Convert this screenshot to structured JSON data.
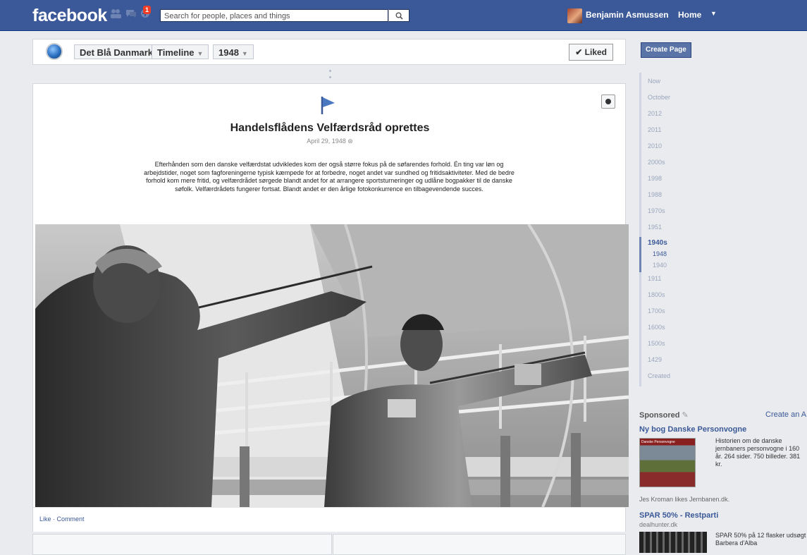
{
  "topbar": {
    "logo": "facebook",
    "notification_count": "1",
    "search_placeholder": "Search for people, places and things",
    "user_name": "Benjamin Asmussen",
    "home_label": "Home"
  },
  "pagehead": {
    "page_name": "Det Blå Danmark",
    "timeline_label": "Timeline",
    "year_label": "1948",
    "liked_label": "✔ Liked"
  },
  "story": {
    "title": "Handelsflådens Velfærdsråd oprettes",
    "date": "April 29, 1948",
    "body": "Efterhånden som den danske velfærdstat udvikledes kom der også større fokus på de søfarendes forhold. Én ting var løn og arbejdstider, noget som fagforeningerne typisk kæmpede for at forbedre, noget andet var sundhed og fritidsaktiviteter. Med de bedre forhold kom mere fritid, og velfærdrådet sørgede blandt andet for at arrangere sportsturneringer og udlåne bogpakker til de danske søfolk. Velfærdrådets fungerer fortsat. Blandt andet er den årlige fotokonkurrence en tilbagevendende succes.",
    "actions": "Like · Comment"
  },
  "sidebar": {
    "create_page": "Create Page",
    "years": [
      {
        "label": "Now"
      },
      {
        "label": "October"
      },
      {
        "label": "2012"
      },
      {
        "label": "2011"
      },
      {
        "label": "2010"
      },
      {
        "label": "2000s"
      },
      {
        "label": "1998"
      },
      {
        "label": "1988"
      },
      {
        "label": "1970s"
      },
      {
        "label": "1951"
      },
      {
        "label": "1940s"
      },
      {
        "label": "1948"
      },
      {
        "label": "1940"
      },
      {
        "label": "1911"
      },
      {
        "label": "1800s"
      },
      {
        "label": "1700s"
      },
      {
        "label": "1600s"
      },
      {
        "label": "1500s"
      },
      {
        "label": "1429"
      },
      {
        "label": "Created"
      }
    ]
  },
  "sponsored": {
    "heading": "Sponsored",
    "create_ad": "Create an A",
    "ad1": {
      "title": "Ny bog Danske Personvogne",
      "image_label": "Danske Personvogne",
      "body": "Historien om de danske jernbaners personvogne i 160 år. 264 sider. 750 billeder. 381 kr.",
      "social": "Jes Kroman likes Jernbanen.dk."
    },
    "ad2": {
      "title": "SPAR 50% - Restparti",
      "domain": "dealhunter.dk",
      "body": "SPAR 50% på 12 flasker udsøgt Barbera d'Alba"
    }
  },
  "colors": {
    "brand": "#3b5998",
    "background": "#e9ebee"
  }
}
